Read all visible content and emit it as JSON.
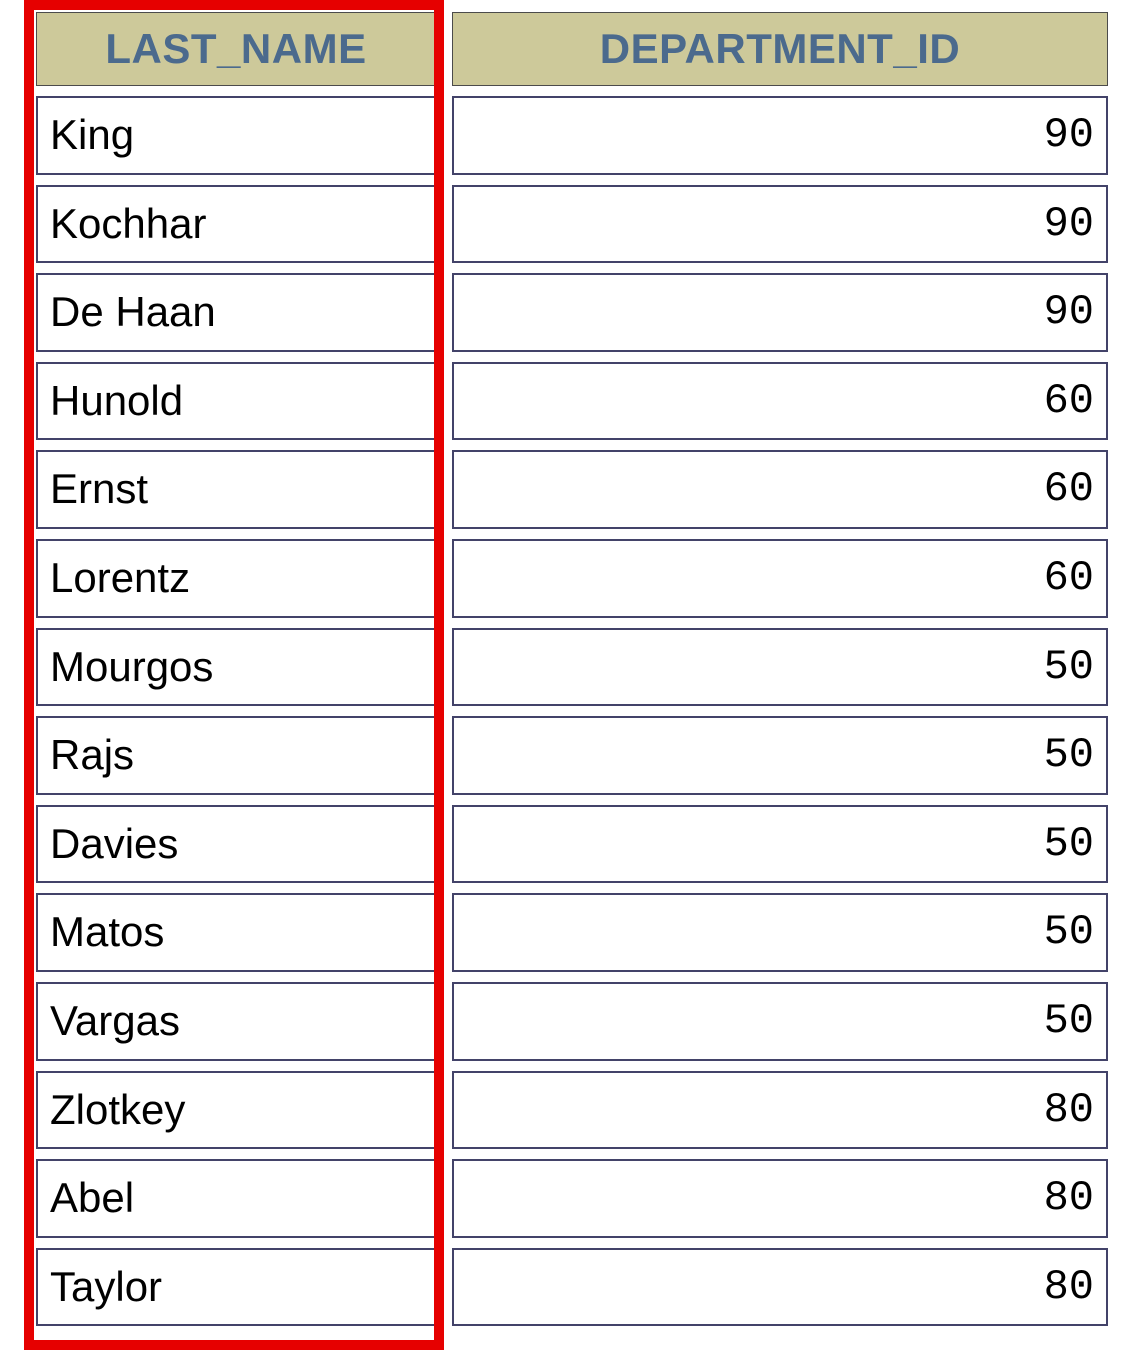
{
  "table": {
    "columns": [
      {
        "header": "LAST_NAME"
      },
      {
        "header": "DEPARTMENT_ID"
      }
    ],
    "rows": [
      {
        "last_name": "King",
        "department_id": "90"
      },
      {
        "last_name": "Kochhar",
        "department_id": "90"
      },
      {
        "last_name": "De Haan",
        "department_id": "90"
      },
      {
        "last_name": "Hunold",
        "department_id": "60"
      },
      {
        "last_name": "Ernst",
        "department_id": "60"
      },
      {
        "last_name": "Lorentz",
        "department_id": "60"
      },
      {
        "last_name": "Mourgos",
        "department_id": "50"
      },
      {
        "last_name": "Rajs",
        "department_id": "50"
      },
      {
        "last_name": "Davies",
        "department_id": "50"
      },
      {
        "last_name": "Matos",
        "department_id": "50"
      },
      {
        "last_name": "Vargas",
        "department_id": "50"
      },
      {
        "last_name": "Zlotkey",
        "department_id": "80"
      },
      {
        "last_name": "Abel",
        "department_id": "80"
      },
      {
        "last_name": "Taylor",
        "department_id": "80"
      }
    ]
  }
}
